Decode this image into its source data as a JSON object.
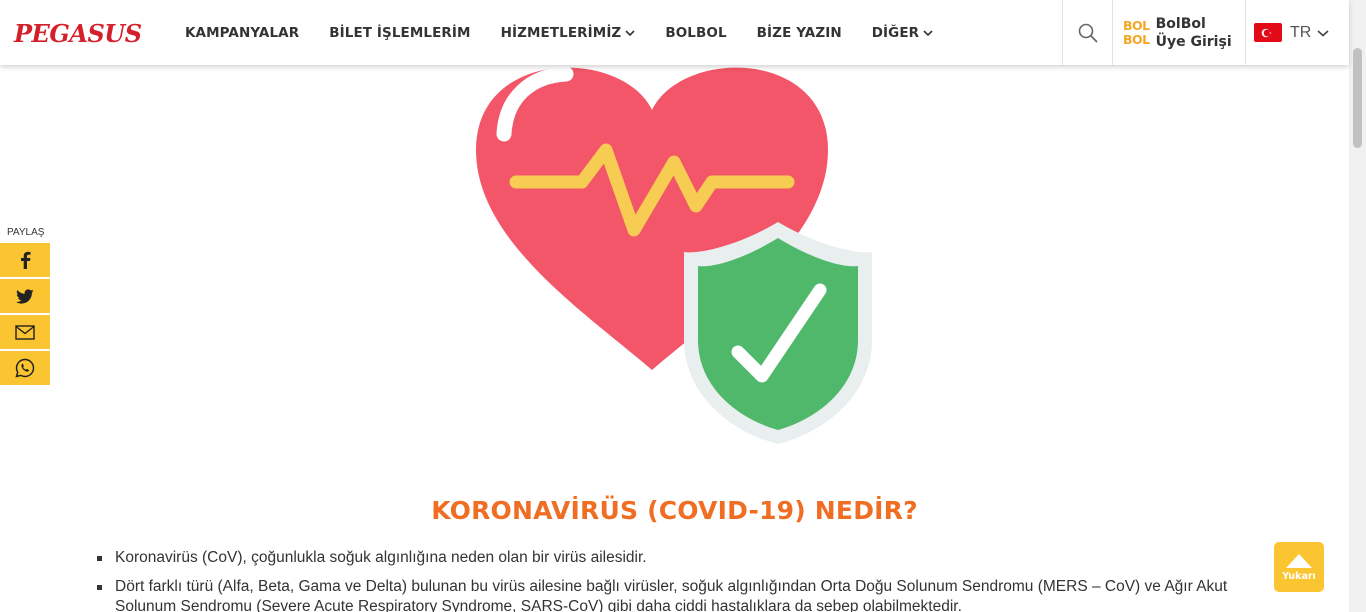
{
  "header": {
    "logo": "PEGASUS",
    "nav": [
      {
        "label": "KAMPANYALAR"
      },
      {
        "label": "BİLET İŞLEMLERİM"
      },
      {
        "label": "HİZMETLERİMİZ"
      },
      {
        "label": "BOLBOL"
      },
      {
        "label": "BİZE YAZIN"
      },
      {
        "label": "DİĞER"
      }
    ],
    "bolbol_logo_line1": "BOL",
    "bolbol_logo_line2": "BOL",
    "bolbol_line1": "BolBol",
    "bolbol_line2": "Üye Girişi",
    "lang": "TR"
  },
  "share": {
    "label": "PAYLAŞ",
    "icons": [
      "facebook-icon",
      "twitter-icon",
      "mail-icon",
      "whatsapp-icon"
    ]
  },
  "content": {
    "title": "KORONAVİRÜS (COVID-19) NEDİR?",
    "bullets": [
      "Koronavirüs (CoV), çoğunlukla soğuk algınlığına neden olan bir virüs ailesidir.",
      "Dört farklı türü (Alfa, Beta, Gama ve Delta) bulunan bu virüs ailesine bağlı virüsler, soğuk algınlığından Orta Doğu Solunum Sendromu (MERS – CoV) ve Ağır Akut Solunum Sendromu (Severe Acute Respiratory Syndrome, SARS-CoV) gibi daha ciddi hastalıklara da sebep olabilmektedir."
    ]
  },
  "to_top": {
    "label": "Yukarı"
  },
  "colors": {
    "brand_red": "#d4202a",
    "accent_yellow": "#fbc531",
    "title_orange": "#f06e23",
    "heart": "#f25668",
    "shield": "#4fb86a"
  }
}
